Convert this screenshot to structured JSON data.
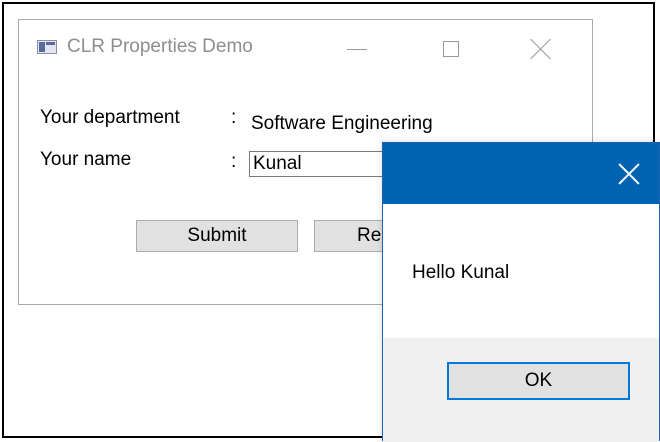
{
  "main_window": {
    "title": "CLR Properties Demo",
    "icon": "wpf-app-icon",
    "caption_buttons": [
      "minimize-icon",
      "maximize-icon",
      "close-icon"
    ],
    "department_label": "Your department",
    "department_colon": ":",
    "department_value": "Software Engineering",
    "name_label": "Your name",
    "name_colon": ":",
    "name_value": "Kunal",
    "submit_label": "Submit",
    "reset_label": "Re"
  },
  "message_box": {
    "title": "",
    "message": "Hello Kunal",
    "ok_label": "OK",
    "titlebar_color": "#0063b1",
    "button_focus_color": "#0078d7"
  }
}
